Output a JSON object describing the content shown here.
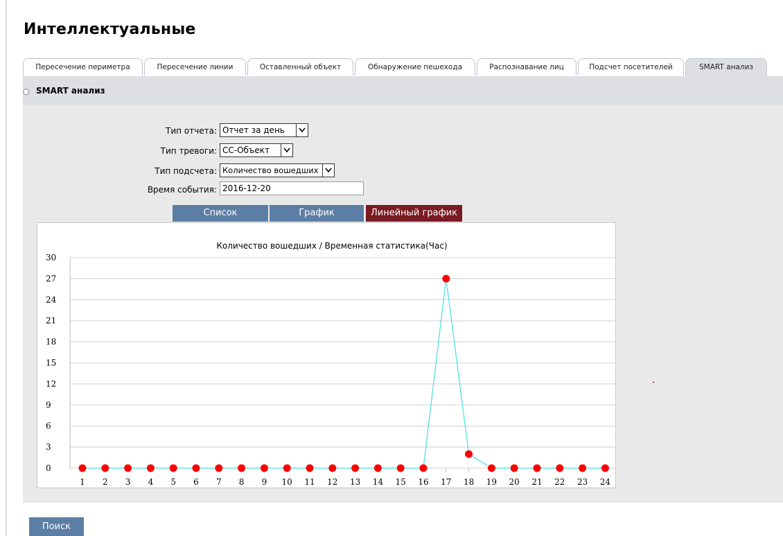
{
  "page": {
    "title": "Интеллектуальные"
  },
  "tabs": [
    {
      "label": "Пересечение периметра",
      "active": false
    },
    {
      "label": "Пересечение линии",
      "active": false
    },
    {
      "label": "Оставленный объект",
      "active": false
    },
    {
      "label": "Обнаружение пешехода",
      "active": false
    },
    {
      "label": "Распознавание лиц",
      "active": false
    },
    {
      "label": "Подсчет посетителей",
      "active": false
    },
    {
      "label": "SMART анализ",
      "active": true
    }
  ],
  "section": {
    "title": "SMART анализ"
  },
  "form": {
    "report_type": {
      "label": "Тип отчета:",
      "value": "Отчет за день"
    },
    "alarm_type": {
      "label": "Тип тревоги:",
      "value": "СС-Объект"
    },
    "count_type": {
      "label": "Тип подсчета:",
      "value": "Количество вошедших"
    },
    "event_time": {
      "label": "Время события:",
      "value": "2016-12-20"
    }
  },
  "view_buttons": {
    "list": "Список",
    "graph": "График",
    "line_graph": "Линейный график"
  },
  "chart_data": {
    "type": "line",
    "title": "Количество вошедших / Временная статистика(Час)",
    "xlabel": "",
    "ylabel": "",
    "categories": [
      "1",
      "2",
      "3",
      "4",
      "5",
      "6",
      "7",
      "8",
      "9",
      "10",
      "11",
      "12",
      "13",
      "14",
      "15",
      "16",
      "17",
      "18",
      "19",
      "20",
      "21",
      "22",
      "23",
      "24"
    ],
    "series": [
      {
        "values": [
          0,
          0,
          0,
          0,
          0,
          0,
          0,
          0,
          0,
          0,
          0,
          0,
          0,
          0,
          0,
          0,
          27,
          2,
          0,
          0,
          0,
          0,
          0,
          0
        ]
      }
    ],
    "ylim": [
      0,
      30
    ],
    "yticks": [
      0,
      3,
      6,
      9,
      12,
      15,
      18,
      21,
      24,
      27,
      30
    ],
    "grid": true,
    "line_color": "#40e0e0",
    "marker_color": "#ff0000"
  },
  "actions": {
    "search": "Поиск"
  }
}
